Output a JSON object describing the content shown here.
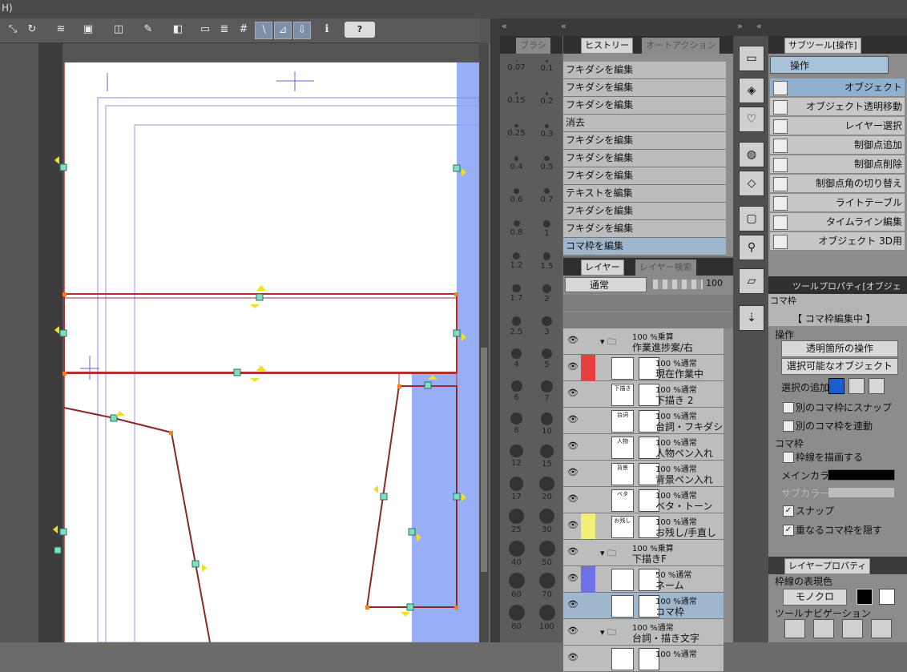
{
  "titlebar": {
    "text": "H)"
  },
  "toolbar": {
    "help_label": "?"
  },
  "brush_panel": {
    "tab_label": "ブラシ",
    "sizes": [
      "0.07",
      "0.1",
      "0.15",
      "0.2",
      "0.25",
      "0.3",
      "0.4",
      "0.5",
      "0.6",
      "0.7",
      "0.8",
      "1",
      "1.2",
      "1.5",
      "1.7",
      "2",
      "2.5",
      "3",
      "4",
      "5",
      "6",
      "7",
      "8",
      "10",
      "12",
      "15",
      "17",
      "20",
      "25",
      "30",
      "40",
      "50",
      "60",
      "70",
      "80",
      "100"
    ]
  },
  "history": {
    "tab_active": "ヒストリー",
    "tab_other": "オートアクション",
    "items": [
      "フキダシを編集",
      "フキダシを編集",
      "フキダシを編集",
      "消去",
      "フキダシを編集",
      "フキダシを編集",
      "フキダシを編集",
      "テキストを編集",
      "フキダシを編集",
      "フキダシを編集",
      "コマ枠を編集"
    ]
  },
  "layers": {
    "tab_active": "レイヤー",
    "tab_other": "レイヤー検索",
    "blend_mode": "通常",
    "opacity": "100",
    "rows": [
      {
        "line1": "100 %乗算",
        "line2": "作業進捗案/右",
        "color": "",
        "thumb": "",
        "folder": true
      },
      {
        "line1": "100 %通常",
        "line2": "現在作業中",
        "color": "#e84040",
        "thumb": ""
      },
      {
        "line1": "100 %通常",
        "line2": "下描き 2",
        "color": "",
        "thumb": "下描き"
      },
      {
        "line1": "100 %通常",
        "line2": "台詞・フキダシ",
        "color": "",
        "thumb": "台詞"
      },
      {
        "line1": "100 %通常",
        "line2": "人物ペン入れ",
        "color": "",
        "thumb": "人物"
      },
      {
        "line1": "100 %通常",
        "line2": "背景ペン入れ",
        "color": "",
        "thumb": "背景"
      },
      {
        "line1": "100 %通常",
        "line2": "ベタ・トーン",
        "color": "",
        "thumb": "ベタ"
      },
      {
        "line1": "100 %通常",
        "line2": "お残し/手直し",
        "color": "#f0ef7a",
        "thumb": "お残し"
      },
      {
        "line1": "100 %乗算",
        "line2": "下描きF",
        "color": "",
        "thumb": "",
        "folder": true
      },
      {
        "line1": "50 %通常",
        "line2": "ネーム",
        "color": "#7070e8",
        "thumb": ""
      },
      {
        "line1": "100 %通常",
        "line2": "コマ枠",
        "color": "",
        "thumb": "",
        "selected": true
      },
      {
        "line1": "100 %通常",
        "line2": "台詞・描き文字",
        "color": "",
        "thumb": "",
        "folder": true
      },
      {
        "line1": "100 %通常",
        "line2": "",
        "color": "",
        "thumb": ""
      }
    ]
  },
  "subtool": {
    "tab_label": "サブツール[操作]",
    "group_label": "操作",
    "items": [
      "オブジェクト",
      "オブジェクト透明移動",
      "レイヤー選択",
      "制御点追加",
      "制御点削除",
      "制御点角の切り替え",
      "ライトテーブル",
      "タイムライン編集",
      "オブジェクト 3D用"
    ]
  },
  "toolprop": {
    "tab_label": "ツールプロパティ[オブジェクト]",
    "preview_label": "コマ枠",
    "banner": "【 コマ枠編集中 】",
    "section_op": "操作",
    "transparent_op": "透明箇所の操作",
    "selectable_obj": "選択可能なオブジェクト",
    "add_select": "選択の追加",
    "snap_other": "別のコマ枠にスナップ",
    "link_other": "別のコマ枠を連動",
    "section_frame": "コマ枠",
    "draw_border": "枠線を描画する",
    "main_color": "メインカラー",
    "sub_color": "サブカラー",
    "snap": "スナップ",
    "hide_overlap": "重なるコマ枠を隠す"
  },
  "layerprop": {
    "tab_label": "レイヤープロパティ",
    "border_expr": "枠線の表現色",
    "mono": "モノクロ",
    "tool_nav": "ツールナビゲーション"
  }
}
